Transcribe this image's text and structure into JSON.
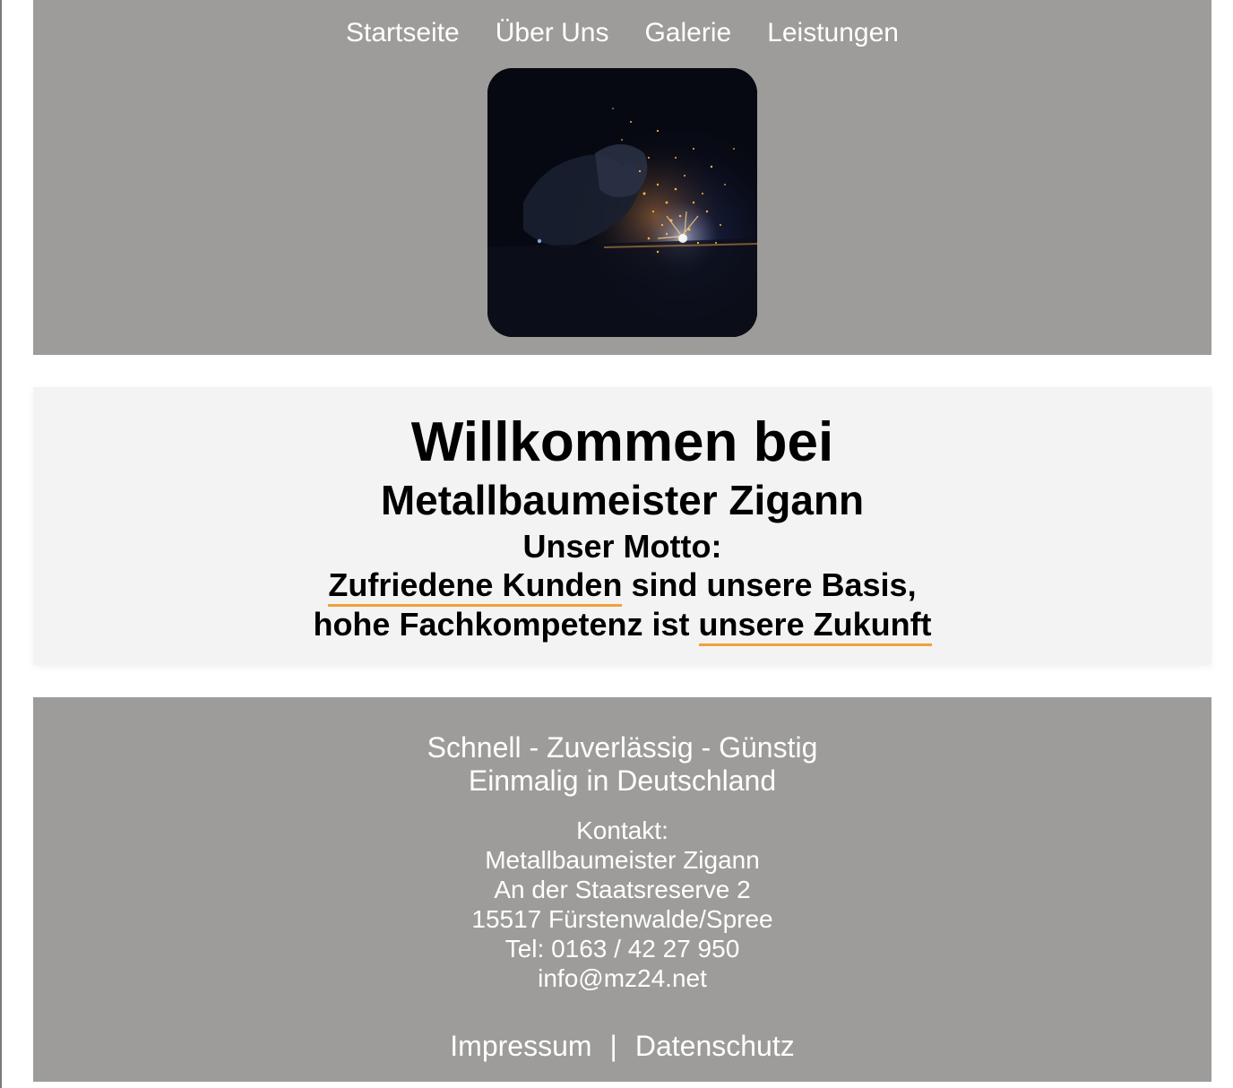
{
  "nav": {
    "items": [
      "Startseite",
      "Über Uns",
      "Galerie",
      "Leistungen"
    ]
  },
  "welcome": {
    "title": "Willkommen bei",
    "subtitle": "Metallbaumeister Zigann",
    "motto_label": "Unser Motto:",
    "line1_highlight": "Zufriedene Kunden",
    "line1_rest": " sind unsere Basis,",
    "line2_start": "hohe Fachkompetenz ist ",
    "line2_highlight": "unsere Zukunft",
    "accent_color": "#f0a13a"
  },
  "footer": {
    "slogan_line1": "Schnell - Zuverlässig - Günstig",
    "slogan_line2": "Einmalig in Deutschland",
    "contact_label": "Kontakt:",
    "contact_name": "Metallbaumeister Zigann",
    "contact_street": "An der Staatsreserve 2",
    "contact_city": "15517 Fürstenwalde/Spree",
    "contact_phone": "Tel: 0163 / 42 27 950",
    "contact_email": "info@mz24.net",
    "link_impressum": "Impressum",
    "link_separator": "|",
    "link_datenschutz": "Datenschutz"
  },
  "colors": {
    "header_bg": "#9d9c9a",
    "welcome_bg": "#f3f3f3"
  },
  "hero_image": "welder-sparks-photo"
}
